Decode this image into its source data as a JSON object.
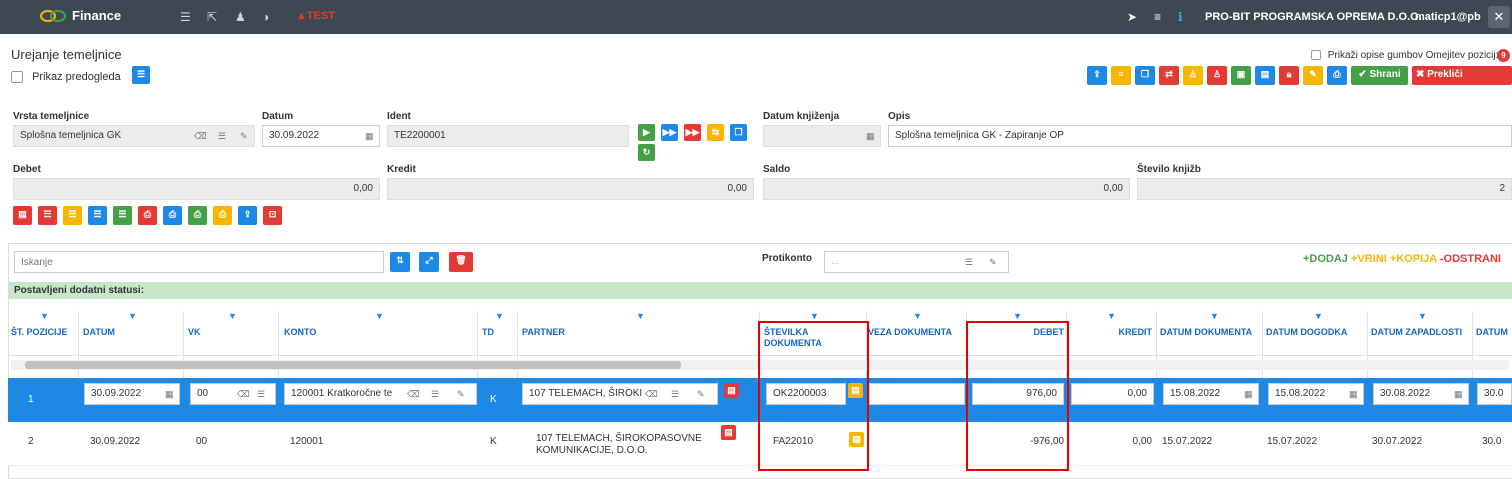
{
  "topbar": {
    "brand": "Finance",
    "test": "▲TEST",
    "company": "PRO-BIT PROGRAMSKA OPREMA D.O.O.",
    "user": "maticp1@pb"
  },
  "page": {
    "title": "Urejanje temeljnice",
    "preview_label": "Prikaz predogleda",
    "desc_toggle_label": "Prikaži opise gumbov Omejitev pozicij:",
    "save_label": "✔ Shrani",
    "cancel_label": "✖ Prekliči"
  },
  "form": {
    "vrsta_label": "Vrsta temeljnice",
    "vrsta_value": "Splošna temeljnica GK",
    "datum_label": "Datum",
    "datum_value": "30.09.2022",
    "ident_label": "Ident",
    "ident_value": "TE2200001",
    "datum_knjizenja_label": "Datum knjiženja",
    "datum_knjizenja_value": "",
    "opis_label": "Opis",
    "opis_value": "Splošna temeljnica GK - Zapiranje OP",
    "debet_label": "Debet",
    "debet_value": "0,00",
    "kredit_label": "Kredit",
    "kredit_value": "0,00",
    "saldo_label": "Saldo",
    "saldo_value": "0,00",
    "stevilo_label": "Število knjižb",
    "stevilo_value": "2"
  },
  "grid": {
    "search_placeholder": "Iskanje",
    "protikonto_label": "Protikonto",
    "protikonto_placeholder": "...",
    "actions": {
      "dodaj": "+DODAJ",
      "vrini": "+VRINI",
      "kopija": "+KOPIJA",
      "odstrani": "-ODSTRANI"
    },
    "status_text": "Postavljeni dodatni statusi:",
    "columns": [
      "ŠT. POZICIJE",
      "DATUM",
      "VK",
      "KONTO",
      "TD",
      "PARTNER",
      "ŠTEVILKA DOKUMENTA",
      "VEZA DOKUMENTA",
      "DEBET",
      "KREDIT",
      "DATUM DOKUMENTA",
      "DATUM DOGODKA",
      "DATUM ZAPADLOSTI",
      "DATUM"
    ],
    "rows": [
      {
        "pos": "1",
        "datum": "30.09.2022",
        "vk": "00",
        "konto": "120001 Kratkoročne te",
        "td": "K",
        "partner": "107 TELEMACH, ŠIROKI",
        "stdok": "OK2200003",
        "veza": "",
        "debet": "976,00",
        "kredit": "0,00",
        "datdok": "15.08.2022",
        "datdog": "15.08.2022",
        "datzap": "30.08.2022",
        "dat": "30.0"
      },
      {
        "pos": "2",
        "datum": "30.09.2022",
        "vk": "00",
        "konto": "120001",
        "td": "K",
        "partner": "107 TELEMACH, ŠIROKOPASOVNE KOMUNIKACIJE, D.O.O.",
        "stdok": "FA22010",
        "veza": "",
        "debet": "-976,00",
        "kredit": "0,00",
        "datdok": "15.07.2022",
        "datdog": "15.07.2022",
        "datzap": "30.07.2022",
        "dat": "30.0"
      }
    ]
  },
  "colors": {
    "topbar": "#3d4852",
    "primary": "#1e88e5",
    "warning": "#f9b600",
    "danger": "#e53935",
    "success": "#43a047",
    "status_bg": "#c8e6c9",
    "highlight": "#e00000"
  }
}
